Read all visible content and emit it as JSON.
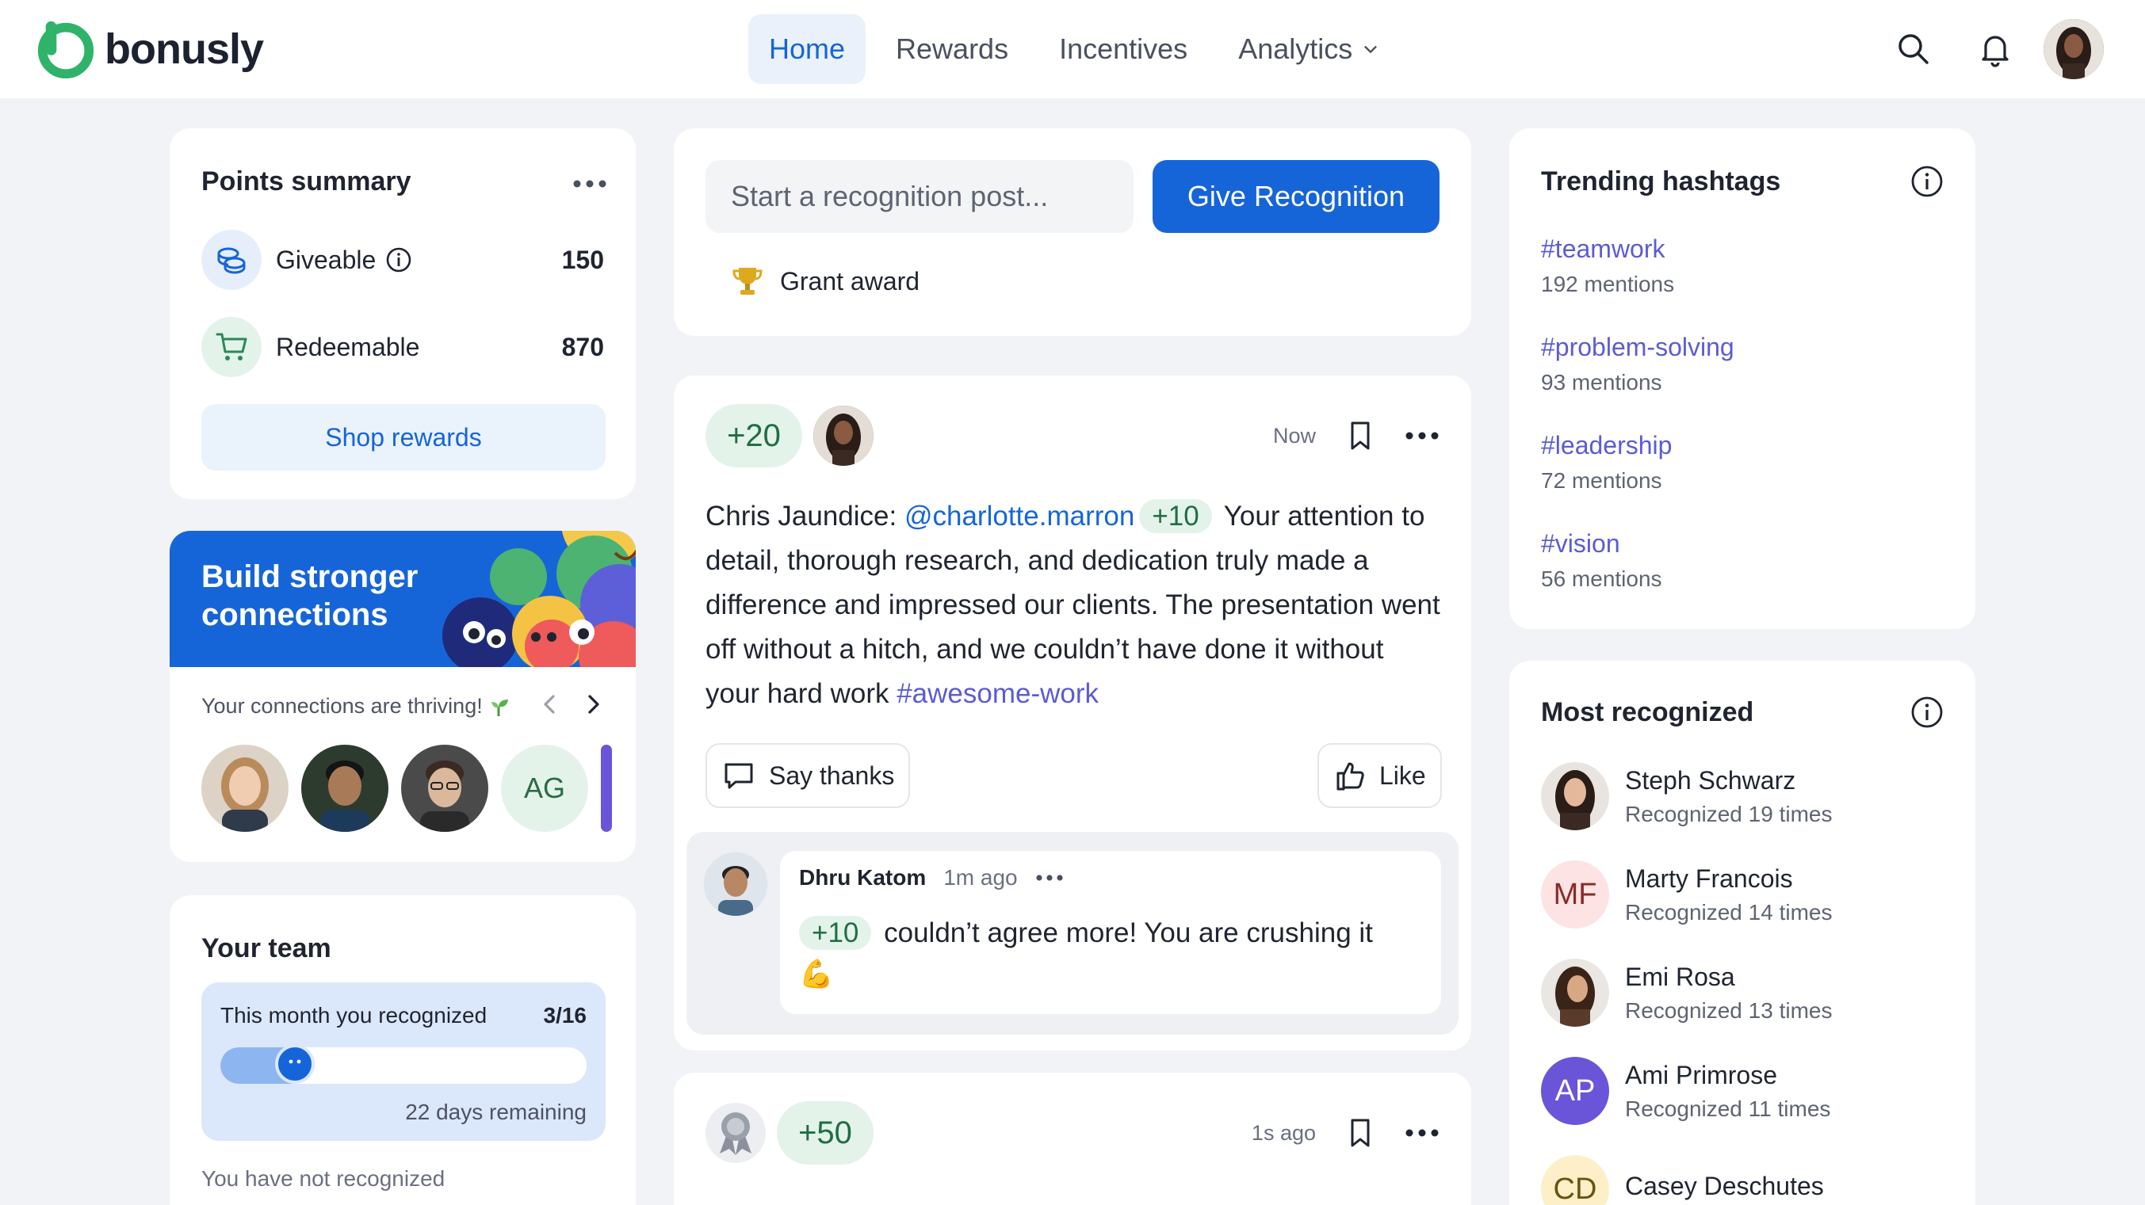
{
  "app": {
    "logo_text": "bonusly",
    "brand_color": "#2fb36b",
    "accent_color": "#1665d8"
  },
  "nav": {
    "items": [
      {
        "label": "Home",
        "active": true
      },
      {
        "label": "Rewards",
        "active": false
      },
      {
        "label": "Incentives",
        "active": false
      },
      {
        "label": "Analytics",
        "active": false,
        "has_dropdown": true
      }
    ],
    "icons": [
      "search-icon",
      "bell-icon",
      "user-avatar"
    ]
  },
  "points_summary": {
    "title": "Points summary",
    "giveable_label": "Giveable",
    "giveable_value": "150",
    "redeemable_label": "Redeemable",
    "redeemable_value": "870",
    "shop_button": "Shop rewards"
  },
  "connections": {
    "title": "Build stronger connections",
    "subtitle": "Your connections are thriving!",
    "avatars": [
      {
        "type": "photo",
        "tone": "#c9a98a"
      },
      {
        "type": "photo",
        "tone": "#6b4e3a"
      },
      {
        "type": "photo",
        "tone": "#8a6a56"
      },
      {
        "type": "initials",
        "initials": "AG"
      }
    ]
  },
  "team": {
    "title": "Your team",
    "recognized_label": "This month you recognized",
    "recognized_value": "3/16",
    "progress_fraction": 0.1875,
    "days_remaining": "22 days remaining",
    "not_recognized": "You have not recognized"
  },
  "composer": {
    "placeholder": "Start a recognition post...",
    "give_button": "Give Recognition",
    "grant_award": "Grant award"
  },
  "post": {
    "points": "+20",
    "time": "Now",
    "author": "Chris Jaundice:",
    "mention": "@charlotte.marron",
    "mention_points": "+10",
    "message": "Your attention to detail, thorough research, and dedication truly made a difference and impressed our clients. The presentation went off without a hitch, and we couldn’t have done it without your hard work",
    "hashtag": "#awesome-work",
    "say_thanks": "Say thanks",
    "like": "Like",
    "comment": {
      "author": "Dhru Katom",
      "time": "1m ago",
      "points": "+10",
      "text": "couldn’t agree more! You are crushing it",
      "emoji": "💪"
    }
  },
  "post2": {
    "points": "+50",
    "time": "1s ago"
  },
  "trending": {
    "title": "Trending hashtags",
    "tags": [
      {
        "name": "#teamwork",
        "count": "192 mentions"
      },
      {
        "name": "#problem-solving",
        "count": "93 mentions"
      },
      {
        "name": "#leadership",
        "count": "72 mentions"
      },
      {
        "name": "#vision",
        "count": "56 mentions"
      }
    ]
  },
  "most_recognized": {
    "title": "Most recognized",
    "people": [
      {
        "name": "Steph Schwarz",
        "count": "Recognized 19 times",
        "avatar": "photo",
        "initials": ""
      },
      {
        "name": "Marty Francois",
        "count": "Recognized 14 times",
        "avatar": "initials",
        "initials": "MF",
        "bg": "#fde3e3",
        "fg": "#8a2a2a"
      },
      {
        "name": "Emi Rosa",
        "count": "Recognized 13 times",
        "avatar": "photo",
        "initials": ""
      },
      {
        "name": "Ami Primrose",
        "count": "Recognized 11 times",
        "avatar": "initials",
        "initials": "AP",
        "bg": "#6a55d9",
        "fg": "#ffffff"
      },
      {
        "name": "Casey Deschutes",
        "count": "",
        "avatar": "initials",
        "initials": "CD",
        "bg": "#fdf0c8",
        "fg": "#6b5310"
      }
    ]
  }
}
